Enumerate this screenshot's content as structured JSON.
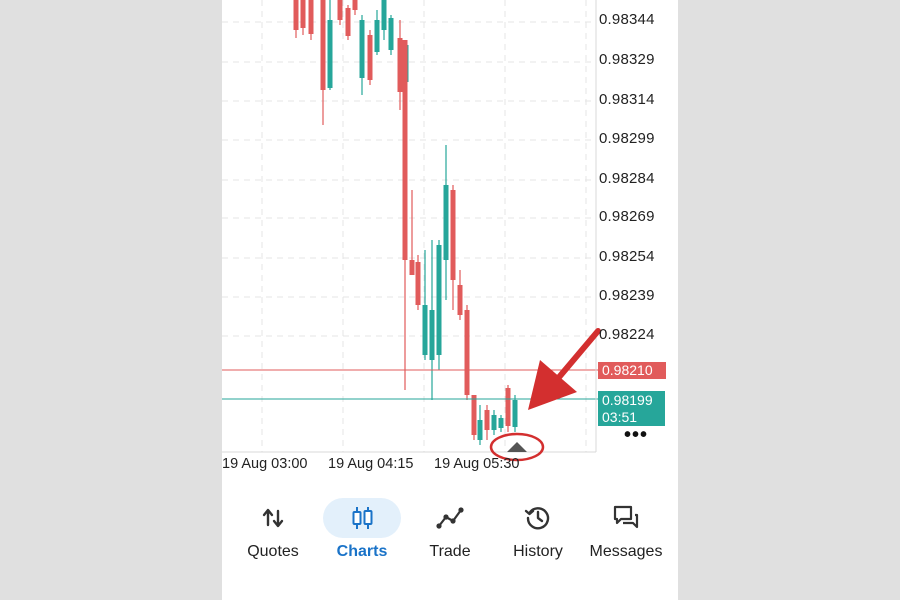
{
  "chart": {
    "price_labels": [
      "0.98344",
      "0.98329",
      "0.98314",
      "0.98299",
      "0.98284",
      "0.98269",
      "0.98254",
      "0.98239",
      "0.98224"
    ],
    "time_labels": [
      "19 Aug 03:00",
      "19 Aug 04:15",
      "19 Aug 05:30"
    ],
    "ask_price": "0.98210",
    "bid_price": "0.98199",
    "countdown": "03:51",
    "more_label": "•••",
    "colors": {
      "bear": "#e15b5b",
      "bull": "#26a69a",
      "annotation": "#d32f2f",
      "grid": "#e4e4e4",
      "active": "#1a73c8"
    }
  },
  "nav": {
    "items": [
      {
        "label": "Quotes",
        "icon": "quotes-arrows-icon"
      },
      {
        "label": "Charts",
        "icon": "candlestick-icon",
        "active": true
      },
      {
        "label": "Trade",
        "icon": "trade-line-icon"
      },
      {
        "label": "History",
        "icon": "history-clock-icon"
      },
      {
        "label": "Messages",
        "icon": "messages-icon"
      }
    ]
  }
}
